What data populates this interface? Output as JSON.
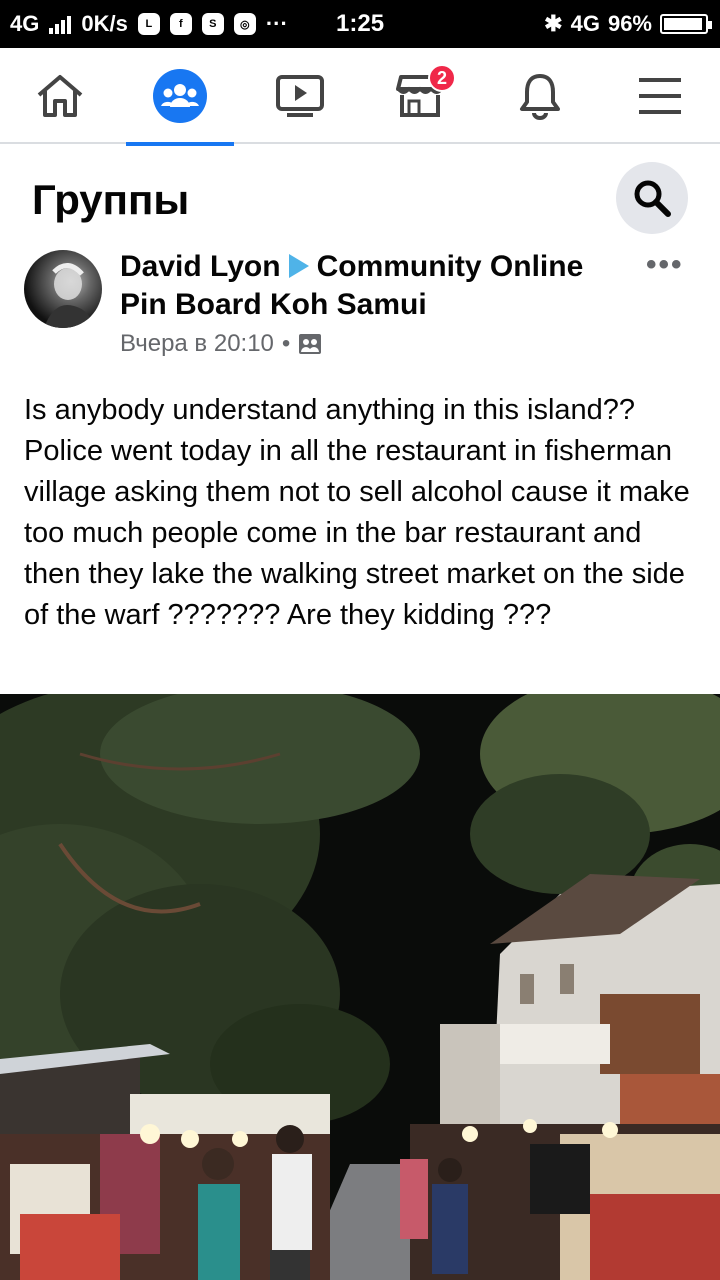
{
  "status_bar": {
    "network": "4G",
    "speed": "0K/s",
    "time": "1:25",
    "network_right": "4G",
    "battery": "96%",
    "battery_level": 0.96,
    "more": "···"
  },
  "nav": {
    "tabs": [
      {
        "name": "home",
        "icon": "home-icon"
      },
      {
        "name": "groups",
        "icon": "groups-icon",
        "active": true
      },
      {
        "name": "watch",
        "icon": "video-icon"
      },
      {
        "name": "marketplace",
        "icon": "marketplace-icon",
        "badge": "2"
      },
      {
        "name": "notifications",
        "icon": "bell-icon"
      },
      {
        "name": "menu",
        "icon": "hamburger-icon"
      }
    ],
    "accent": "#1877f2",
    "badge_color": "#f02849"
  },
  "header": {
    "title": "Группы"
  },
  "post": {
    "author": "David Lyon",
    "group": "Community Online Pin Board Koh Samui",
    "time": "Вчера в 20:10",
    "separator": "•",
    "more": "•••",
    "text": "Is anybody understand anything in this island?? Police went today in all the restaurant in fisherman village asking them not to sell alcohol cause it make too much people come in the bar restaurant and then they lake the walking street market on the side of the warf ??????? Are they kidding ???"
  }
}
